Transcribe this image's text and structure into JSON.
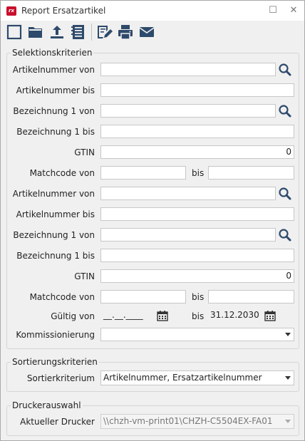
{
  "window": {
    "title": "Report Ersatzartikel",
    "logo_text": "rx",
    "maximize_glyph": "☐",
    "close_glyph": "✕"
  },
  "toolbar": {
    "icons": [
      "new-icon",
      "open-folder-icon",
      "upload-icon",
      "list-icon",
      "edit-report-icon",
      "print-icon",
      "email-icon"
    ]
  },
  "selection": {
    "legend": "Selektionskriterien",
    "block1": {
      "artnr_von_label": "Artikelnummer von",
      "artnr_von_value": "",
      "artnr_bis_label": "Artikelnummer bis",
      "artnr_bis_value": "",
      "bez_von_label": "Bezeichnung 1 von",
      "bez_von_value": "",
      "bez_bis_label": "Bezeichnung 1 bis",
      "bez_bis_value": "",
      "gtin_label": "GTIN",
      "gtin_value": "0",
      "matchcode_label": "Matchcode von",
      "matchcode_von_value": "",
      "bis_label": "bis",
      "matchcode_bis_value": ""
    },
    "block2": {
      "artnr_von_label": "Artikelnummer von",
      "artnr_von_value": "",
      "artnr_bis_label": "Artikelnummer bis",
      "artnr_bis_value": "",
      "bez_von_label": "Bezeichnung 1 von",
      "bez_von_value": "",
      "bez_bis_label": "Bezeichnung 1 bis",
      "bez_bis_value": "",
      "gtin_label": "GTIN",
      "gtin_value": "0",
      "matchcode_label": "Matchcode von",
      "matchcode_von_value": "",
      "bis_label": "bis",
      "matchcode_bis_value": ""
    },
    "gueltig_label": "Gültig von",
    "gueltig_von_value": "__.__.____",
    "gueltig_bis_label": "bis",
    "gueltig_bis_value": "31.12.2030",
    "kommission_label": "Kommissionierung",
    "kommission_value": ""
  },
  "sorting": {
    "legend": "Sortierungskriterien",
    "label": "Sortierkriterium",
    "value": "Artikelnummer, Ersatzartikelnummer"
  },
  "printer": {
    "legend": "Druckerauswahl",
    "label": "Aktueller Drucker",
    "value": "\\\\chzh-vm-print01\\CHZH-C5504EX-FA01"
  }
}
